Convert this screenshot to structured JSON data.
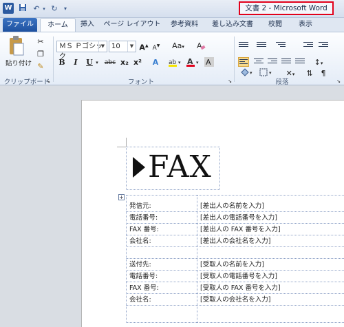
{
  "window": {
    "title": "文書 2 - Microsoft Word"
  },
  "qat": {
    "logo": "W",
    "save_icon": "save-icon",
    "undo_icon": "undo-icon",
    "redo_icon": "redo-icon"
  },
  "tabs": [
    {
      "label": "ファイル"
    },
    {
      "label": "ホーム"
    },
    {
      "label": "挿入"
    },
    {
      "label": "ページ レイアウト"
    },
    {
      "label": "参考資料"
    },
    {
      "label": "差し込み文書"
    },
    {
      "label": "校閲"
    },
    {
      "label": "表示"
    }
  ],
  "ribbon": {
    "clipboard": {
      "paste_label": "貼り付け",
      "group_label": "クリップボード"
    },
    "font": {
      "font_name": "ＭＳ Ｐゴシック",
      "font_size": "10",
      "group_label": "フォント",
      "bold": "B",
      "italic": "I",
      "underline": "U",
      "strike": "abc",
      "sub": "x₂",
      "sup": "x²",
      "case": "Aa",
      "grow": "A",
      "shrink": "A",
      "clear": "A"
    },
    "paragraph": {
      "group_label": "段落"
    }
  },
  "document": {
    "heading": "FAX",
    "sender_rows": [
      {
        "label": "発信元:",
        "value": "[差出人の名前を入力]"
      },
      {
        "label": "電話番号:",
        "value": "[差出人の電話番号を入力]"
      },
      {
        "label": "FAX 番号:",
        "value": "[差出人の FAX 番号を入力]"
      },
      {
        "label": "会社名:",
        "value": "[差出人の会社名を入力]"
      }
    ],
    "recipient_rows": [
      {
        "label": "送付先:",
        "value": "[受取人の名前を入力]"
      },
      {
        "label": "電話番号:",
        "value": "[受取人の電話番号を入力]"
      },
      {
        "label": "FAX 番号:",
        "value": "[受取人の FAX 番号を入力]"
      },
      {
        "label": "会社名:",
        "value": "[受取人の会社名を入力]"
      }
    ]
  }
}
